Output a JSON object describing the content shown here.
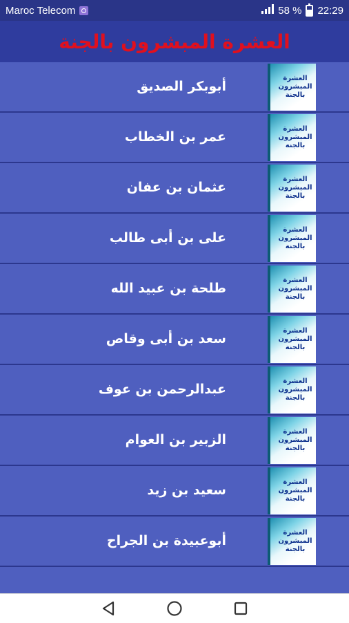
{
  "status_bar": {
    "carrier": "Maroc Telecom",
    "battery_percent": "58 %",
    "battery_level": 0.58,
    "time": "22:29",
    "icons": [
      "carrier-badge-icon",
      "signal-icon",
      "battery-icon"
    ]
  },
  "header": {
    "title": "العشرة المبشرون بالجنة",
    "title_color": "#e0101e",
    "background": "#2f3c9e"
  },
  "list": {
    "background": "#4f5fbf",
    "items": [
      {
        "label": "أبوبكر الصديق",
        "thumb_text": "العشرة المبشرون بالجنة"
      },
      {
        "label": "عمر بن الخطاب",
        "thumb_text": "العشرة المبشرون بالجنة"
      },
      {
        "label": "عثمان بن عفان",
        "thumb_text": "العشرة المبشرون بالجنة"
      },
      {
        "label": "على بن أبى طالب",
        "thumb_text": "العشرة المبشرون بالجنة"
      },
      {
        "label": "طلحة بن عبيد الله",
        "thumb_text": "العشرة المبشرون بالجنة"
      },
      {
        "label": "سعد بن أبى وقاص",
        "thumb_text": "العشرة المبشرون بالجنة"
      },
      {
        "label": "عبدالرحمن بن عوف",
        "thumb_text": "العشرة المبشرون بالجنة"
      },
      {
        "label": "الزبير بن العوام",
        "thumb_text": "العشرة المبشرون بالجنة"
      },
      {
        "label": "سعيد بن زيد",
        "thumb_text": "العشرة المبشرون بالجنة"
      },
      {
        "label": "أبوعبيدة بن الجراح",
        "thumb_text": "العشرة المبشرون بالجنة"
      }
    ]
  },
  "nav_bar": {
    "buttons": [
      "back-icon",
      "home-icon",
      "recents-icon"
    ]
  }
}
